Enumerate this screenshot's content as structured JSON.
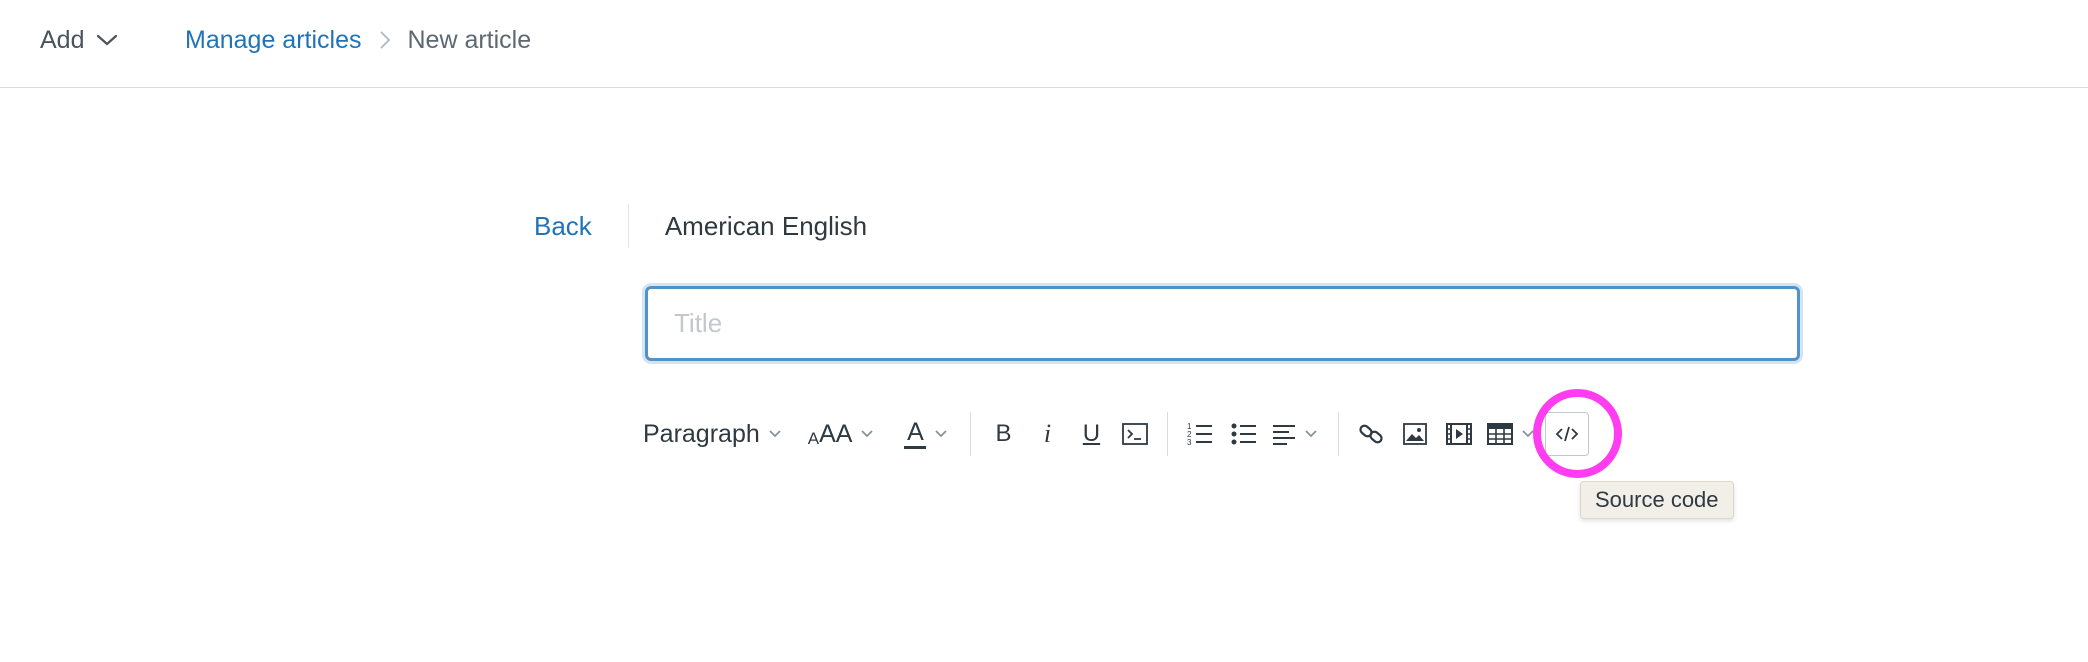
{
  "header": {
    "add_label": "Add",
    "breadcrumb": {
      "parent": "Manage articles",
      "current": "New article"
    }
  },
  "editor": {
    "back_label": "Back",
    "locale": "American English",
    "title_placeholder": "Title",
    "title_value": ""
  },
  "toolbar": {
    "block_format": "Paragraph",
    "font_size_glyph": "AA",
    "text_color_glyph": "A",
    "bold_glyph": "B",
    "italic_glyph": "i",
    "underline_glyph": "U",
    "buttons": [
      "bold",
      "italic",
      "underline",
      "code-block",
      "numbered-list",
      "bulleted-list",
      "align",
      "link",
      "image",
      "video",
      "table",
      "source-code"
    ],
    "tooltip": "Source code"
  },
  "colors": {
    "link": "#1f73b7",
    "focus_border": "#5293c7",
    "highlight_ring": "#ff3df0"
  }
}
